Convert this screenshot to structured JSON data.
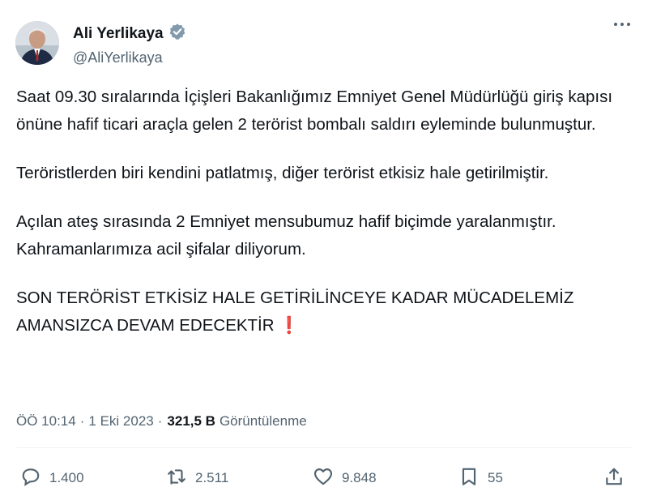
{
  "author": {
    "name": "Ali Yerlikaya",
    "handle": "@AliYerlikaya",
    "verified_icon": "verified-badge-icon",
    "avatar_icon": "avatar"
  },
  "tweet": {
    "paragraphs": [
      "Saat 09.30 sıralarında İçişleri Bakanlığımız Emniyet Genel Müdürlüğü giriş kapısı önüne hafif ticari araçla gelen 2 terörist bombalı saldırı eyleminde bulunmuştur.",
      "Teröristlerden biri kendini patlatmış, diğer terörist etkisiz hale getirilmiştir.",
      "Açılan ateş sırasında 2 Emniyet mensubumuz hafif biçimde yaralanmıştır. Kahramanlarımıza acil şifalar diliyorum.",
      "SON TERÖRİST ETKİSİZ HALE GETİRİLİNCEYE KADAR MÜCADELEMİZ AMANSIZCA DEVAM EDECEKTİR"
    ],
    "closing_emoji": "❗"
  },
  "meta": {
    "time": "ÖÖ 10:14",
    "separator": "·",
    "date": "1 Eki 2023",
    "views_count": "321,5 B",
    "views_label": "Görüntülenme"
  },
  "actions": {
    "replies": "1.400",
    "retweets": "2.511",
    "likes": "9.848",
    "bookmarks": "55"
  },
  "colors": {
    "text": "#0f1419",
    "secondary": "#536471",
    "verified": "#829aab",
    "exclamation": "#e02424"
  }
}
